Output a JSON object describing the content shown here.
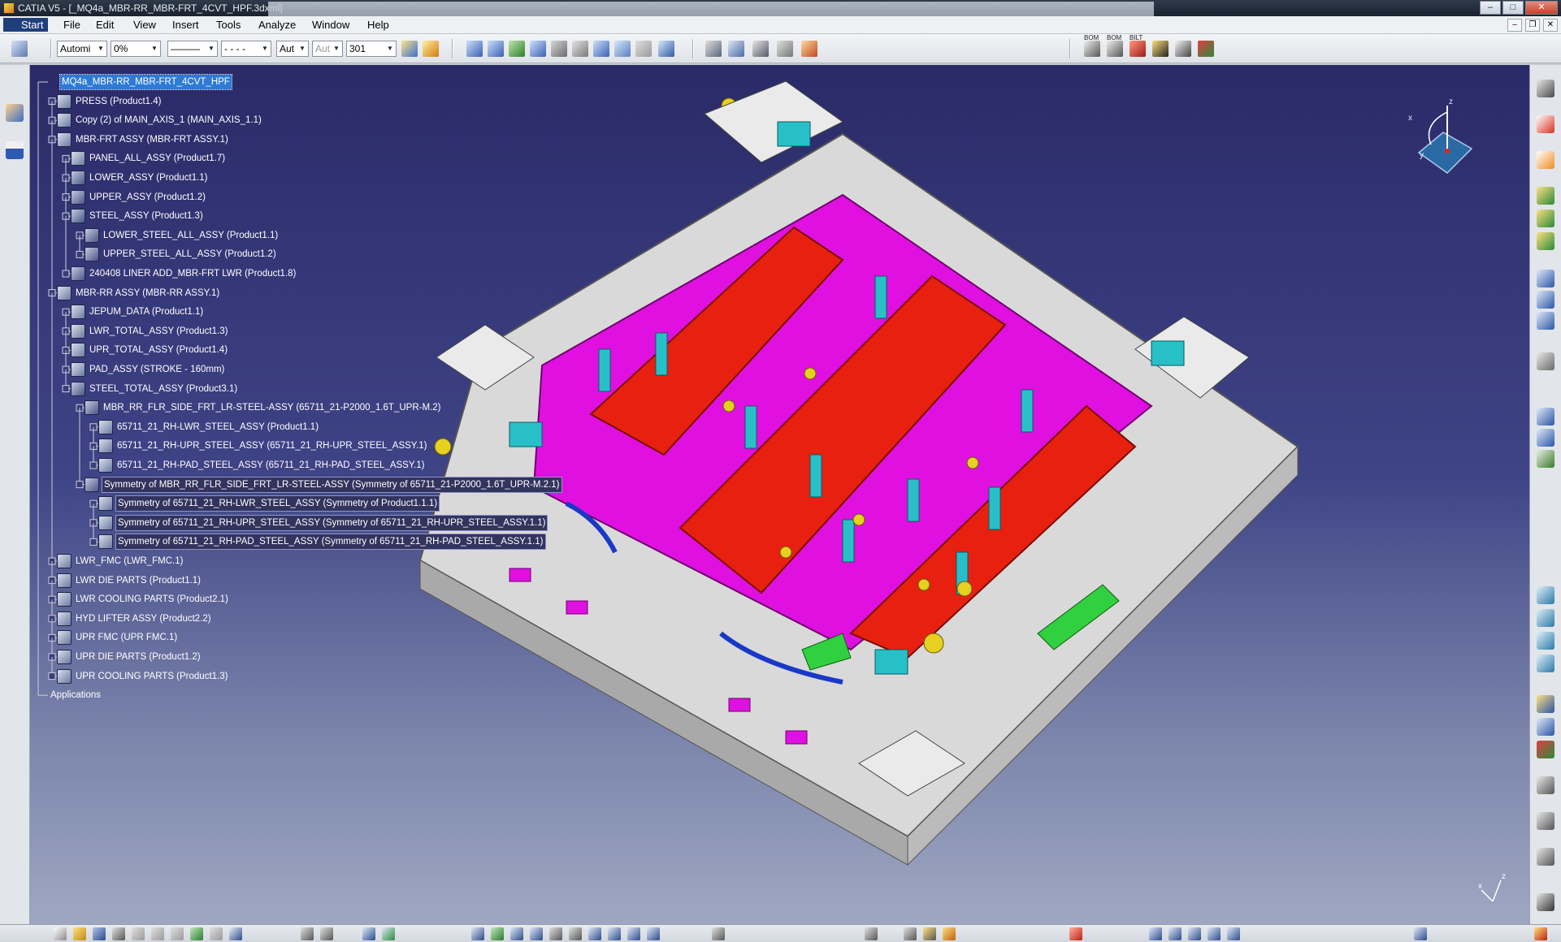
{
  "window": {
    "title": "CATIA V5 - [_MQ4a_MBR-RR_MBR-FRT_4CVT_HPF.3dxml]",
    "buttons": {
      "minimize": "–",
      "maximize": "□",
      "close": "✕"
    }
  },
  "menubar": {
    "items": [
      "Start",
      "File",
      "Edit",
      "View",
      "Insert",
      "Tools",
      "Analyze",
      "Window",
      "Help"
    ],
    "mdi": {
      "minimize": "–",
      "restore": "❐",
      "close": "✕"
    }
  },
  "toolbar": {
    "combos": [
      {
        "value": "Automi"
      },
      {
        "value": "0%"
      },
      {
        "value": "———"
      },
      {
        "value": "- - - -"
      },
      {
        "value": "Aut"
      },
      {
        "value": "Aut"
      },
      {
        "value": "301"
      }
    ],
    "bom_labels": [
      "BOM",
      "BOM",
      "BILT"
    ]
  },
  "tree": {
    "nodes": [
      {
        "label": "MQ4a_MBR-RR_MBR-FRT_4CVT_HPF",
        "level": 0,
        "type": "root"
      },
      {
        "label": "PRESS (Product1.4)",
        "level": 1,
        "type": "prod"
      },
      {
        "label": "Copy (2) of MAIN_AXIS_1 (MAIN_AXIS_1.1)",
        "level": 1,
        "type": "prod"
      },
      {
        "label": "MBR-FRT ASSY (MBR-FRT ASSY.1)",
        "level": 1,
        "type": "prod"
      },
      {
        "label": "PANEL_ALL_ASSY (Product1.7)",
        "level": 2,
        "type": "prod"
      },
      {
        "label": "LOWER_ASSY (Product1.1)",
        "level": 2,
        "type": "part"
      },
      {
        "label": "UPPER_ASSY (Product1.2)",
        "level": 2,
        "type": "part"
      },
      {
        "label": "STEEL_ASSY (Product1.3)",
        "level": 2,
        "type": "part"
      },
      {
        "label": "LOWER_STEEL_ALL_ASSY (Product1.1)",
        "level": 3,
        "type": "part"
      },
      {
        "label": "UPPER_STEEL_ALL_ASSY (Product1.2)",
        "level": 3,
        "type": "part"
      },
      {
        "label": "240408 LINER ADD_MBR-FRT LWR (Product1.8)",
        "level": 2,
        "type": "part"
      },
      {
        "label": "MBR-RR ASSY (MBR-RR ASSY.1)",
        "level": 1,
        "type": "prod"
      },
      {
        "label": "JEPUM_DATA (Product1.1)",
        "level": 2,
        "type": "prod"
      },
      {
        "label": "LWR_TOTAL_ASSY (Product1.3)",
        "level": 2,
        "type": "prod"
      },
      {
        "label": "UPR_TOTAL_ASSY (Product1.4)",
        "level": 2,
        "type": "prod"
      },
      {
        "label": "PAD_ASSY (STROKE - 160mm)",
        "level": 2,
        "type": "prod"
      },
      {
        "label": "STEEL_TOTAL_ASSY (Product3.1)",
        "level": 2,
        "type": "part"
      },
      {
        "label": "MBR_RR_FLR_SIDE_FRT_LR-STEEL-ASSY (65711_21-P2000_1.6T_UPR-M.2)",
        "level": 3,
        "type": "part"
      },
      {
        "label": "65711_21_RH-LWR_STEEL_ASSY (Product1.1)",
        "level": 4,
        "type": "prod"
      },
      {
        "label": "65711_21_RH-UPR_STEEL_ASSY (65711_21_RH-UPR_STEEL_ASSY.1)",
        "level": 4,
        "type": "prod"
      },
      {
        "label": "65711_21_RH-PAD_STEEL_ASSY (65711_21_RH-PAD_STEEL_ASSY.1)",
        "level": 4,
        "type": "prod"
      },
      {
        "label": "Symmetry of MBR_RR_FLR_SIDE_FRT_LR-STEEL-ASSY (Symmetry of 65711_21-P2000_1.6T_UPR-M.2.1)",
        "level": 3,
        "type": "part",
        "hl": true
      },
      {
        "label": "Symmetry of 65711_21_RH-LWR_STEEL_ASSY (Symmetry of Product1.1.1)",
        "level": 4,
        "type": "prod",
        "hl": true
      },
      {
        "label": "Symmetry of 65711_21_RH-UPR_STEEL_ASSY (Symmetry of 65711_21_RH-UPR_STEEL_ASSY.1.1)",
        "level": 4,
        "type": "prod",
        "hl": true
      },
      {
        "label": "Symmetry of 65711_21_RH-PAD_STEEL_ASSY (Symmetry of 65711_21_RH-PAD_STEEL_ASSY.1.1)",
        "level": 4,
        "type": "prod",
        "hl": true
      },
      {
        "label": "LWR_FMC (LWR_FMC.1)",
        "level": 1,
        "type": "prod"
      },
      {
        "label": "LWR DIE PARTS (Product1.1)",
        "level": 1,
        "type": "prod"
      },
      {
        "label": "LWR COOLING PARTS (Product2.1)",
        "level": 1,
        "type": "prod"
      },
      {
        "label": "HYD LIFTER ASSY (Product2.2)",
        "level": 1,
        "type": "prod"
      },
      {
        "label": "UPR FMC (UPR FMC.1)",
        "level": 1,
        "type": "prod"
      },
      {
        "label": "UPR DIE PARTS (Product1.2)",
        "level": 1,
        "type": "prod"
      },
      {
        "label": "UPR COOLING PARTS (Product1.3)",
        "level": 1,
        "type": "prod"
      },
      {
        "label": "Applications",
        "level": 0,
        "type": "app"
      }
    ]
  },
  "compass": {
    "x_label": "x",
    "y_label": "y",
    "z_label": "z"
  },
  "axes": {
    "x_label": "x",
    "z_label": "z"
  },
  "colors": {
    "viewport_top": "#2b2a68",
    "viewport_bottom": "#9ea7c2",
    "die_base": "#dcdcdc",
    "die_plate": "#e010e0",
    "part_red": "#e82010",
    "pin_cyan": "#28c0c8",
    "bolt_yellow": "#e6d020"
  }
}
